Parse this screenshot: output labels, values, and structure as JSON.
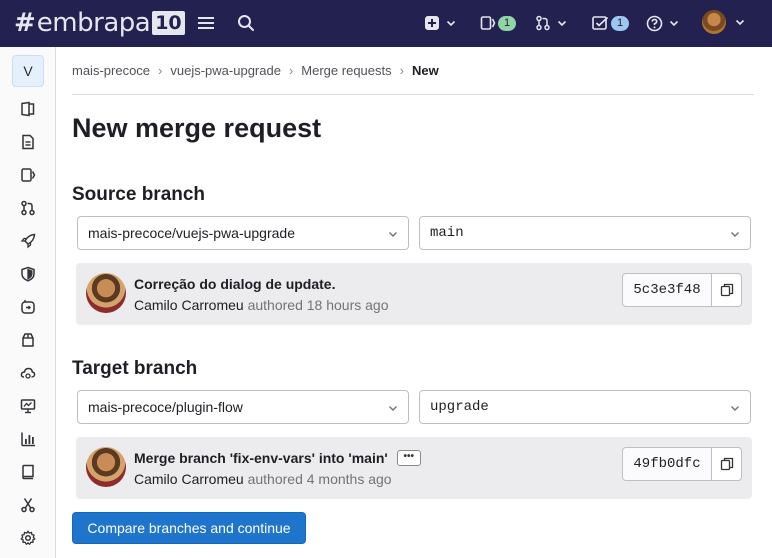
{
  "topbar": {
    "logo_prefix": "#",
    "logo_word": "embrapa",
    "logo_badge": "10",
    "issues_count": "1",
    "todos_count": "1",
    "icons": [
      "menu-icon",
      "search-icon",
      "plus-square-icon",
      "issues-icon",
      "merge-request-icon",
      "todo-icon",
      "help-icon",
      "user-avatar"
    ],
    "badge_colors": {
      "issues": "#91d4a8",
      "todos": "#9dc7f1"
    }
  },
  "sidebar": {
    "project_initial": "V",
    "items": [
      "project-overview-icon",
      "repository-icon",
      "issues-icon",
      "merge-requests-icon",
      "ci-cd-rocket-icon",
      "security-shield-icon",
      "deployments-icon",
      "packages-icon",
      "infrastructure-icon",
      "monitor-icon",
      "analytics-icon",
      "wiki-icon",
      "snippets-icon",
      "settings-icon"
    ]
  },
  "breadcrumb": {
    "items": [
      "mais-precoce",
      "vuejs-pwa-upgrade",
      "Merge requests"
    ],
    "current": "New",
    "separator": "›"
  },
  "page": {
    "title": "New merge request"
  },
  "source": {
    "title": "Source branch",
    "project": "mais-precoce/vuejs-pwa-upgrade",
    "branch": "main",
    "commit": {
      "message": "Correção do dialog de update.",
      "author": "Camilo Carromeu",
      "when": "authored 18 hours ago",
      "sha": "5c3e3f48"
    }
  },
  "target": {
    "title": "Target branch",
    "project": "mais-precoce/plugin-flow",
    "branch": "upgrade",
    "commit": {
      "message": "Merge branch 'fix-env-vars' into 'main'",
      "ellipsis": "•••",
      "author": "Camilo Carromeu",
      "when": "authored 4 months ago",
      "sha": "49fb0dfc"
    }
  },
  "actions": {
    "compare_label": "Compare branches and continue"
  },
  "colors": {
    "topbar": "#232150",
    "primary": "#1f75cb",
    "card_bg": "#ececef"
  }
}
